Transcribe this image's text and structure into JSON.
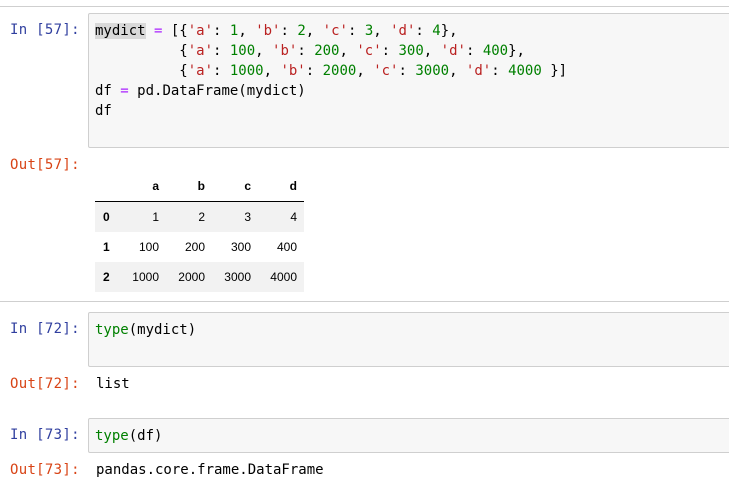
{
  "cells": [
    {
      "in_prompt": "In [57]:",
      "out_prompt": "Out[57]:",
      "code_lines": [
        [
          [
            "hl",
            "mydict"
          ],
          [
            "p",
            " "
          ],
          [
            "op",
            "="
          ],
          [
            "p",
            " [{"
          ],
          [
            "str",
            "'a'"
          ],
          [
            "p",
            ": "
          ],
          [
            "num",
            "1"
          ],
          [
            "p",
            ", "
          ],
          [
            "str",
            "'b'"
          ],
          [
            "p",
            ": "
          ],
          [
            "num",
            "2"
          ],
          [
            "p",
            ", "
          ],
          [
            "str",
            "'c'"
          ],
          [
            "p",
            ": "
          ],
          [
            "num",
            "3"
          ],
          [
            "p",
            ", "
          ],
          [
            "str",
            "'d'"
          ],
          [
            "p",
            ": "
          ],
          [
            "num",
            "4"
          ],
          [
            "p",
            "},"
          ]
        ],
        [
          [
            "p",
            "          {"
          ],
          [
            "str",
            "'a'"
          ],
          [
            "p",
            ": "
          ],
          [
            "num",
            "100"
          ],
          [
            "p",
            ", "
          ],
          [
            "str",
            "'b'"
          ],
          [
            "p",
            ": "
          ],
          [
            "num",
            "200"
          ],
          [
            "p",
            ", "
          ],
          [
            "str",
            "'c'"
          ],
          [
            "p",
            ": "
          ],
          [
            "num",
            "300"
          ],
          [
            "p",
            ", "
          ],
          [
            "str",
            "'d'"
          ],
          [
            "p",
            ": "
          ],
          [
            "num",
            "400"
          ],
          [
            "p",
            "},"
          ]
        ],
        [
          [
            "p",
            "          {"
          ],
          [
            "str",
            "'a'"
          ],
          [
            "p",
            ": "
          ],
          [
            "num",
            "1000"
          ],
          [
            "p",
            ", "
          ],
          [
            "str",
            "'b'"
          ],
          [
            "p",
            ": "
          ],
          [
            "num",
            "2000"
          ],
          [
            "p",
            ", "
          ],
          [
            "str",
            "'c'"
          ],
          [
            "p",
            ": "
          ],
          [
            "num",
            "3000"
          ],
          [
            "p",
            ", "
          ],
          [
            "str",
            "'d'"
          ],
          [
            "p",
            ": "
          ],
          [
            "num",
            "4000"
          ],
          [
            "p",
            " }]"
          ]
        ],
        [
          [
            "p",
            "df "
          ],
          [
            "op",
            "="
          ],
          [
            "p",
            " pd.DataFrame(mydict)"
          ]
        ],
        [
          [
            "p",
            "df"
          ]
        ]
      ],
      "table": {
        "columns": [
          "a",
          "b",
          "c",
          "d"
        ],
        "rows": [
          {
            "index": "0",
            "values": [
              "1",
              "2",
              "3",
              "4"
            ]
          },
          {
            "index": "1",
            "values": [
              "100",
              "200",
              "300",
              "400"
            ]
          },
          {
            "index": "2",
            "values": [
              "1000",
              "2000",
              "3000",
              "4000"
            ]
          }
        ]
      }
    },
    {
      "in_prompt": "In [72]:",
      "out_prompt": "Out[72]:",
      "code_lines": [
        [
          [
            "bi",
            "type"
          ],
          [
            "p",
            "(mydict)"
          ]
        ]
      ],
      "output": "list"
    },
    {
      "in_prompt": "In [73]:",
      "out_prompt": "Out[73]:",
      "code_lines": [
        [
          [
            "bi",
            "type"
          ],
          [
            "p",
            "(df)"
          ]
        ]
      ],
      "output": "pandas.core.frame.DataFrame"
    }
  ]
}
